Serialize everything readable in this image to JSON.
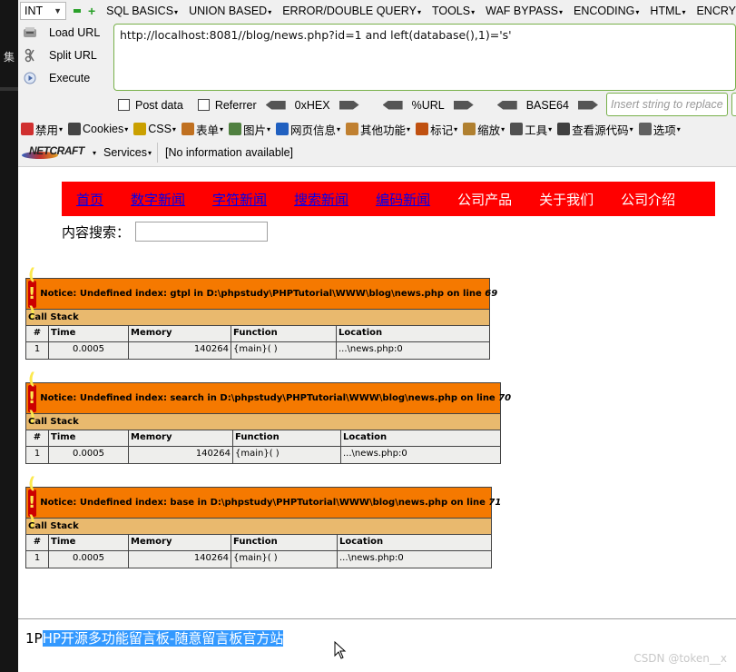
{
  "left_strip": {
    "glyph": "集"
  },
  "hackbar": {
    "select_value": "INT",
    "menu": [
      "SQL BASICS",
      "UNION BASED",
      "ERROR/DOUBLE QUERY",
      "TOOLS",
      "WAF BYPASS",
      "ENCODING",
      "HTML",
      "ENCRY"
    ],
    "side_buttons": {
      "load": "Load URL",
      "split": "Split URL",
      "execute": "Execute"
    },
    "url": "http://localhost:8081//blog/news.php?id=1 and left(database(),1)='s'",
    "options": {
      "post_data": "Post data",
      "referrer": "Referrer",
      "hex": "0xHEX",
      "url_enc": "%URL",
      "base64": "BASE64",
      "replace_placeholder": "Insert string to replace"
    }
  },
  "webdev_toolbar": [
    {
      "label": "禁用",
      "icon": "disable-icon",
      "color": "#d03030"
    },
    {
      "label": "Cookies",
      "icon": "cookies-icon",
      "color": "#444444"
    },
    {
      "label": "CSS",
      "icon": "css-icon",
      "color": "#caa000"
    },
    {
      "label": "表单",
      "icon": "forms-icon",
      "color": "#c07020"
    },
    {
      "label": "图片",
      "icon": "images-icon",
      "color": "#508040"
    },
    {
      "label": "网页信息",
      "icon": "info-icon",
      "color": "#2060c0"
    },
    {
      "label": "其他功能",
      "icon": "misc-icon",
      "color": "#c08030"
    },
    {
      "label": "标记",
      "icon": "outline-icon",
      "color": "#c05010"
    },
    {
      "label": "缩放",
      "icon": "resize-icon",
      "color": "#b08030"
    },
    {
      "label": "工具",
      "icon": "tools-icon",
      "color": "#505050"
    },
    {
      "label": "查看源代码",
      "icon": "view-source-icon",
      "color": "#404040"
    },
    {
      "label": "选项",
      "icon": "options-icon",
      "color": "#606060"
    }
  ],
  "netcraft": {
    "logo": "NETCRAFT",
    "services": "Services",
    "info": "[No information available]"
  },
  "site": {
    "nav": [
      {
        "label": "首页",
        "style": "lnk"
      },
      {
        "label": "数字新闻",
        "style": "lnk"
      },
      {
        "label": "字符新闻",
        "style": "lnk"
      },
      {
        "label": "搜索新闻",
        "style": "lnk"
      },
      {
        "label": "编码新闻",
        "style": "lnk"
      },
      {
        "label": "公司产品",
        "style": "wht"
      },
      {
        "label": "关于我们",
        "style": "wht"
      },
      {
        "label": "公司介绍",
        "style": "wht"
      }
    ],
    "search_label": "内容搜索：",
    "notices": [
      {
        "message": "Notice: Undefined index: gtpl in D:\\phpstudy\\PHPTutorial\\WWW\\blog\\news.php on line ",
        "line": "69",
        "call_stack": "Call Stack",
        "headers": [
          "#",
          "Time",
          "Memory",
          "Function",
          "Location"
        ],
        "row": [
          "1",
          "0.0005",
          "140264",
          "{main}( )",
          "...\\news.php:0"
        ]
      },
      {
        "message": "Notice: Undefined index: search in D:\\phpstudy\\PHPTutorial\\WWW\\blog\\news.php on line ",
        "line": "70",
        "call_stack": "Call Stack",
        "headers": [
          "#",
          "Time",
          "Memory",
          "Function",
          "Location"
        ],
        "row": [
          "1",
          "0.0005",
          "140264",
          "{main}( )",
          "...\\news.php:0"
        ]
      },
      {
        "message": "Notice: Undefined index: base in D:\\phpstudy\\PHPTutorial\\WWW\\blog\\news.php on line ",
        "line": "71",
        "call_stack": "Call Stack",
        "headers": [
          "#",
          "Time",
          "Memory",
          "Function",
          "Location"
        ],
        "row": [
          "1",
          "0.0005",
          "140264",
          "{main}( )",
          "...\\news.php:0"
        ]
      }
    ],
    "footer_prefix": "1P",
    "footer_selected": "HP开源多功能留言板-随意留言板官方站"
  },
  "watermark": "CSDN @token__x"
}
